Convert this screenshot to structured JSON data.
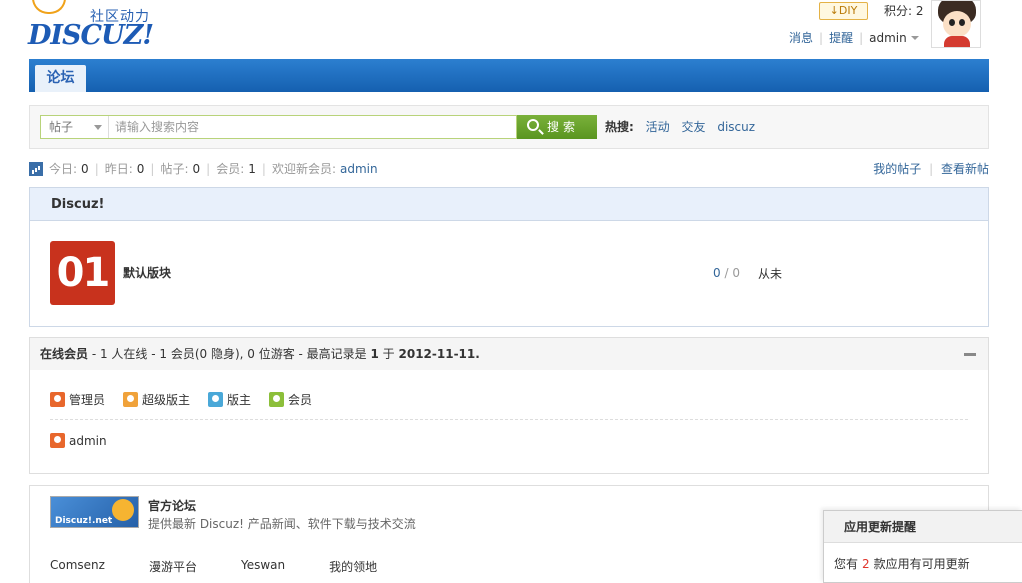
{
  "header": {
    "logo_slogan": "社区动力",
    "logo_word": "DISCUZ!",
    "diy_label": "DIY",
    "points_label": "积分: 2",
    "links": [
      "消息",
      "提醒",
      "admin"
    ]
  },
  "nav": {
    "tab_label": "论坛"
  },
  "search": {
    "type_label": "帖子",
    "placeholder": "请输入搜索内容",
    "button_label": "搜索",
    "hot_label": "热搜:",
    "hot_items": [
      "活动",
      "交友",
      "discuz"
    ]
  },
  "stats": {
    "today_label": "今日:",
    "today_value": "0",
    "yesterday_label": "昨日:",
    "yesterday_value": "0",
    "posts_label": "帖子:",
    "posts_value": "0",
    "members_label": "会员:",
    "members_value": "1",
    "welcome_label": "欢迎新会员:",
    "newest_member": "admin",
    "my_posts": "我的帖子",
    "new_posts": "查看新帖"
  },
  "category": {
    "title": "Discuz!",
    "forum_icon_text": "01",
    "forum_name": "默认版块",
    "threads": "0",
    "posts": "0",
    "last_post": "从未"
  },
  "online": {
    "title": "在线会员",
    "summary": " - 1 人在线  - 1 会员(0 隐身), 0 位游客  - 最高记录是 ",
    "record_count": "1",
    "record_sep": " 于 ",
    "record_date": "2012-11-11.",
    "legend": [
      {
        "label": "管理员",
        "color": "#e8672c"
      },
      {
        "label": "超级版主",
        "color": "#f0a23a"
      },
      {
        "label": "版主",
        "color": "#4aa8d8"
      },
      {
        "label": "会员",
        "color": "#8cbf3a"
      }
    ],
    "users": [
      "admin"
    ]
  },
  "links_block": {
    "logo_text": "Discuz!.net",
    "title": "官方论坛",
    "desc": "提供最新 Discuz! 产品新闻、软件下载与技术交流",
    "friends": [
      "Comsenz",
      "漫游平台",
      "Yeswan",
      "我的领地"
    ]
  },
  "notify": {
    "title": "应用更新提醒",
    "prefix": "您有",
    "count": "2",
    "suffix": "款应用有可用更新"
  }
}
